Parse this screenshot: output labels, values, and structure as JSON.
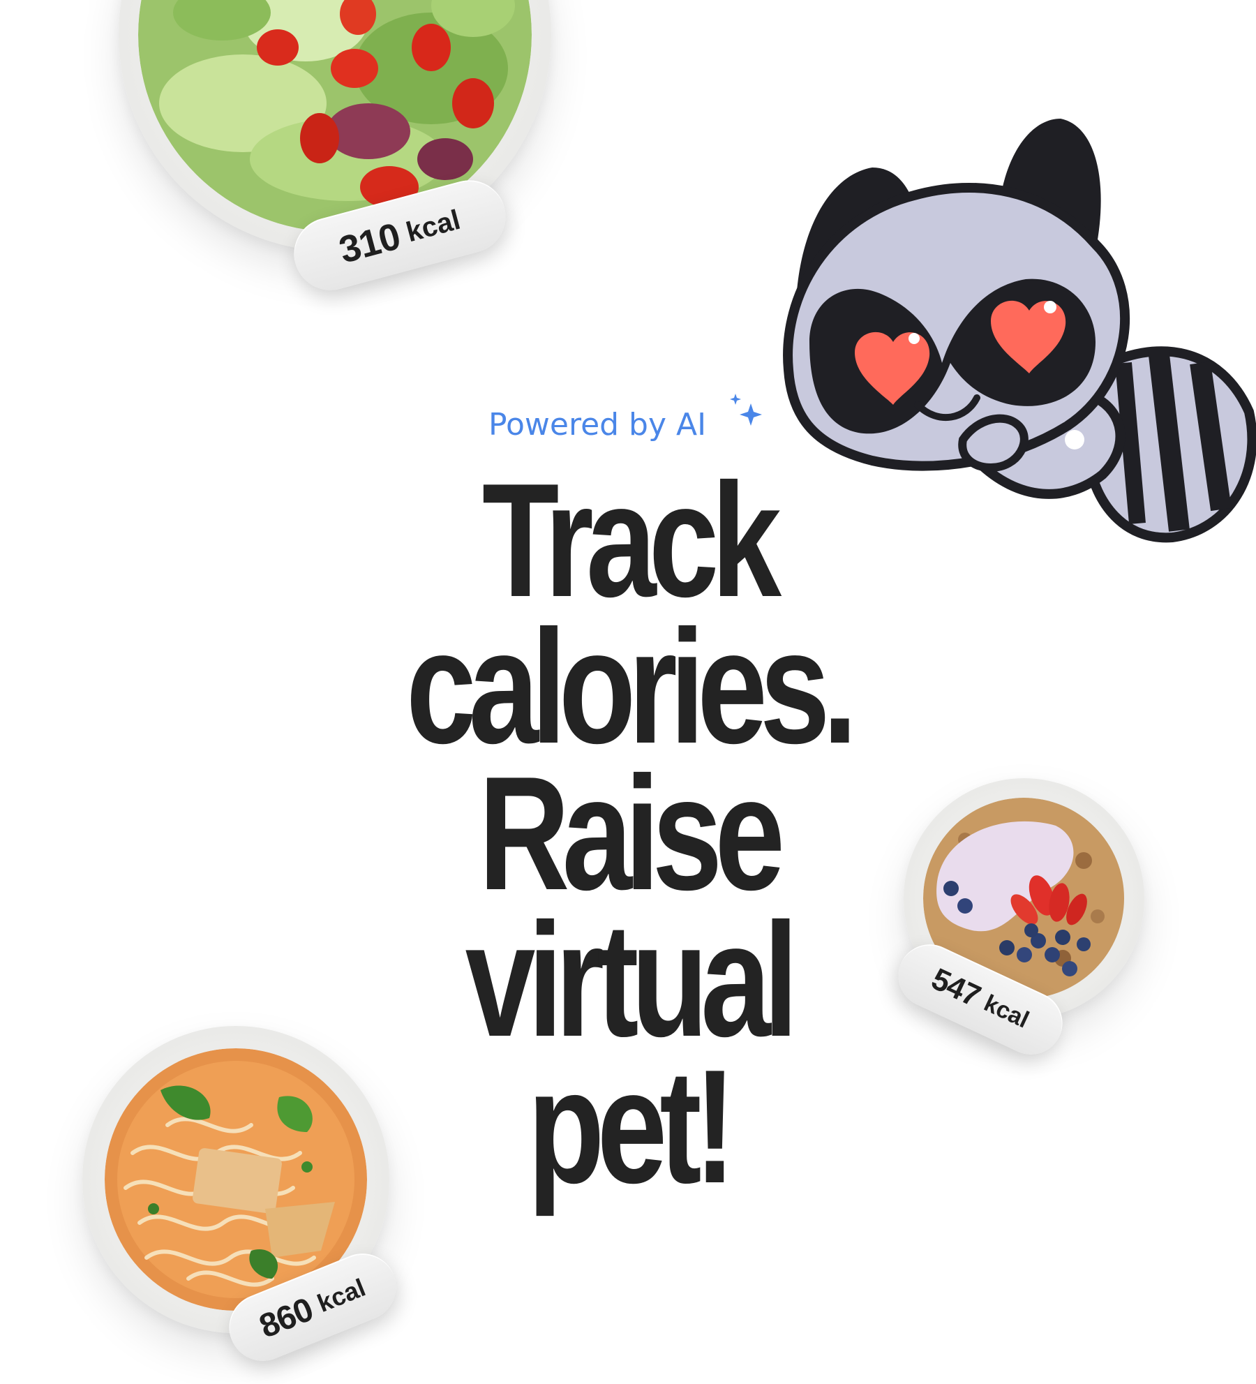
{
  "hero": {
    "powered_label": "Powered by AI",
    "sparkle_icon": "sparkle-icon",
    "headline_lines": [
      "Track",
      "calories.",
      "Raise",
      "virtual",
      "pet!"
    ]
  },
  "meals": [
    {
      "name": "salad",
      "calories": "310",
      "unit": "kcal",
      "icon": "salad-bowl-icon"
    },
    {
      "name": "yogurt-bowl",
      "calories": "547",
      "unit": "kcal",
      "icon": "yogurt-bowl-icon"
    },
    {
      "name": "noodle-soup",
      "calories": "860",
      "unit": "kcal",
      "icon": "noodle-soup-icon"
    }
  ],
  "mascot": {
    "icon": "raccoon-mascot-icon"
  },
  "colors": {
    "accent": "#4a86e8",
    "heart": "#ff6a5b",
    "ink": "#232323",
    "fur": "#c8c9dd"
  }
}
